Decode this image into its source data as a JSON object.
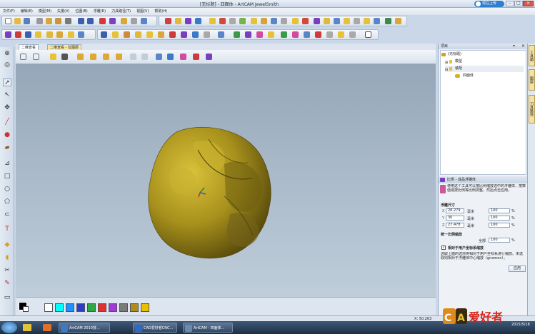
{
  "app": {
    "title": "[无标题] - 四面体 - ArtCAM JewelSmith",
    "login_label": "现在上传"
  },
  "menu": [
    "文件(F)",
    "编辑(E)",
    "模型(M)",
    "矢量(V)",
    "位图(B)",
    "浮雕(R)",
    "刀具路径(T)",
    "视图(V)",
    "帮助(H)"
  ],
  "view_tabs": [
    "二维查看",
    "二维查看 - 位图层"
  ],
  "project_panel": {
    "title": "项目",
    "tree": [
      "(无标题)",
      "模型",
      "装配",
      "四面体"
    ]
  },
  "scale_panel": {
    "title": "比例 - 成品浮雕体",
    "desc": "使用这个工具可以按比例缩放选中的浮雕体，按数值或按比例等比例调整，然后点击应用。",
    "size_heading": "浮雕尺寸",
    "rows": [
      {
        "axis": "X",
        "value": "28.279",
        "unit": "毫米",
        "pct": "100",
        "pct_unit": "%"
      },
      {
        "axis": "Y",
        "value": "30",
        "unit": "毫米",
        "pct": "100",
        "pct_unit": "%"
      },
      {
        "axis": "Z",
        "value": "27.478",
        "unit": "毫米",
        "pct": "100",
        "pct_unit": "%"
      }
    ],
    "uniform_heading": "统一比例缩放",
    "uniform_label": "全部",
    "uniform_value": "100",
    "uniform_unit": "%",
    "checkbox_label": "相对于用户坐标系缩放",
    "note": "选取上面的选项将相对于用户坐标系进行缩放。未选取则相对于浮雕体中心缩放（gnomon）。",
    "apply_label": "应用"
  },
  "side_tabs": [
    "工具箱",
    "图层",
    "刀具路径"
  ],
  "status": {
    "coords": "X: 50.263"
  },
  "palette_colors": [
    "#000000",
    "#ffffff",
    "#ffffff",
    "#00ffff",
    "#1e90ff",
    "#2f3cc8",
    "#2ea84a",
    "#e03030",
    "#a33ad8",
    "#7a7a7a",
    "#b08a20",
    "#e8c000"
  ],
  "taskbar": {
    "items": [
      "ArtCAM 2010技...",
      "CAD爱好者CNC...",
      "ArtCAM - 四面体..."
    ]
  },
  "logo_text": "爱好者",
  "watermark_sub": "2015/5/18"
}
